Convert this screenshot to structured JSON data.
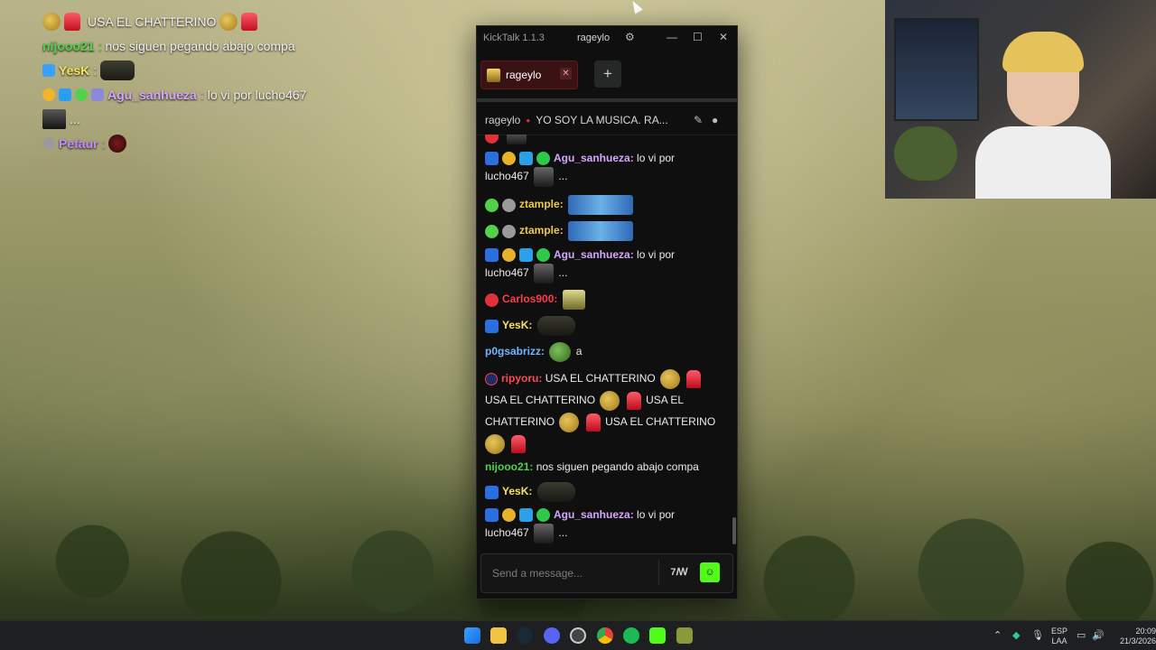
{
  "overlay_chat": {
    "line1": "USA EL CHATTERINO",
    "line2_user": "nijooo21",
    "line2_text": "nos siguen pegando abajo compa",
    "line3_user": "YesK",
    "line4_user": "Agu_sanhueza",
    "line4_text": "lo vi por lucho467",
    "line5_text": "...",
    "line6_user": "Pefaur"
  },
  "app": {
    "name": "KickTalk 1.1.3",
    "user": "rageylo"
  },
  "tabs": [
    {
      "label": "rageylo"
    }
  ],
  "channel": {
    "name": "rageylo",
    "title": "YO SOY LA MUSICA. RA..."
  },
  "messages": [
    {
      "user": "Agu_sanhueza",
      "color": "#d6a6ff",
      "text": "lo vi por",
      "text2": "lucho467",
      "text3": "..."
    },
    {
      "user": "ztample",
      "color": "#f1c94a"
    },
    {
      "user": "ztample",
      "color": "#f1c94a"
    },
    {
      "user": "Agu_sanhueza",
      "color": "#d6a6ff",
      "text": "lo vi por",
      "text2": "lucho467",
      "text3": "..."
    },
    {
      "user": "Carlos900",
      "color": "#ff3b4a"
    },
    {
      "user": "YesK",
      "color": "#f6e35b"
    },
    {
      "user": "p0gsabrizz",
      "color": "#6fb7ff",
      "text": "a"
    },
    {
      "user": "ripyoru",
      "color": "#ff4a5a",
      "text": "USA EL CHATTERINO",
      "text2": "USA EL CHATTERINO",
      "text3": "USA EL",
      "text4": "CHATTERINO",
      "text5": "USA EL CHATTERINO"
    },
    {
      "user": "nijooo21",
      "color": "#53d14a",
      "text": "nos siguen pegando abajo compa"
    },
    {
      "user": "YesK",
      "color": "#f6e35b"
    },
    {
      "user": "Agu_sanhueza",
      "color": "#d6a6ff",
      "text": "lo vi por",
      "text2": "lucho467",
      "text3": "..."
    }
  ],
  "composer": {
    "placeholder": "Send a message..."
  },
  "taskbar": {
    "lang": "ESP",
    "layout": "LAA",
    "time": "20:09",
    "date": "21/3/2026"
  },
  "colors": {
    "kick_green": "#53fc18",
    "accent_red": "#e0303a"
  }
}
